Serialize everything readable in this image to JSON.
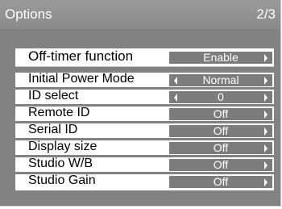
{
  "header": {
    "title": "Options",
    "page": "2/3"
  },
  "rows": [
    {
      "label": "Off-timer function",
      "value": "Enable",
      "left_arrow": false,
      "right_arrow": true
    },
    {
      "label": "Initial Power Mode",
      "value": "Normal",
      "left_arrow": true,
      "right_arrow": true
    },
    {
      "label": "ID select",
      "value": "0",
      "left_arrow": true,
      "right_arrow": true
    },
    {
      "label": "Remote ID",
      "value": "Off",
      "left_arrow": false,
      "right_arrow": true
    },
    {
      "label": "Serial ID",
      "value": "Off",
      "left_arrow": false,
      "right_arrow": true
    },
    {
      "label": "Display size",
      "value": "Off",
      "left_arrow": false,
      "right_arrow": true
    },
    {
      "label": "Studio W/B",
      "value": "Off",
      "left_arrow": false,
      "right_arrow": true
    },
    {
      "label": "Studio Gain",
      "value": "Off",
      "left_arrow": false,
      "right_arrow": true
    }
  ]
}
